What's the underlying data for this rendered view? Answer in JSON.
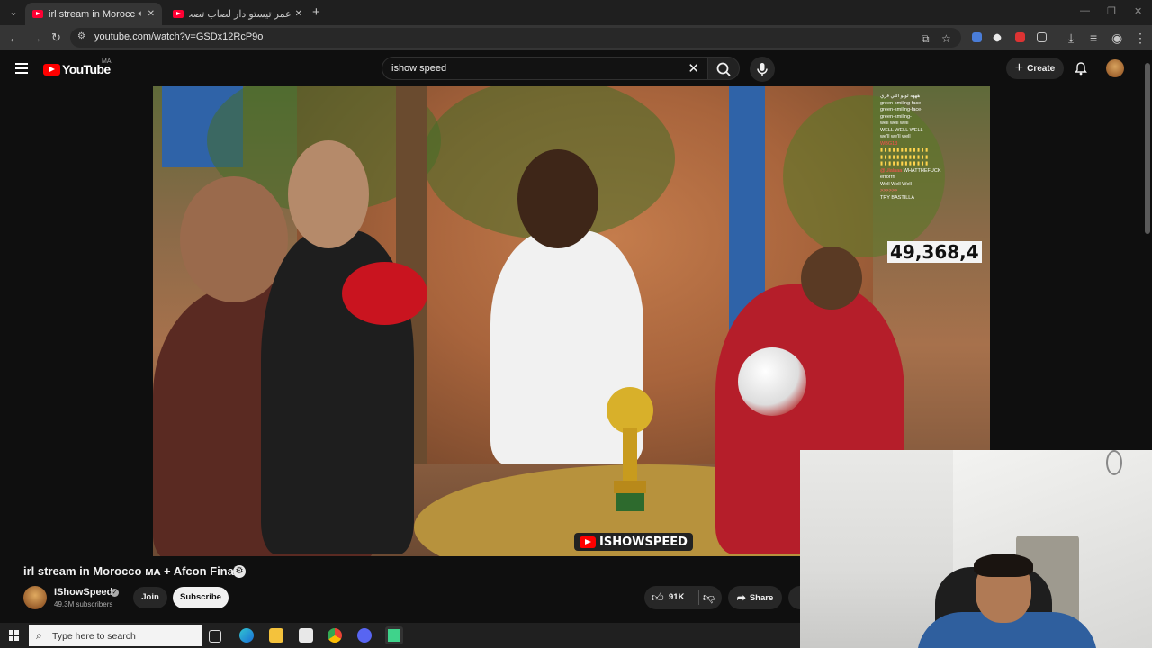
{
  "browser": {
    "tabs": [
      {
        "title": "irl stream in Morocco MA +",
        "active": true
      },
      {
        "title": "عمر تيستو دار لصاب تصب | البرو",
        "active": false
      }
    ],
    "url": "youtube.com/watch?v=GSDx12RcP9o"
  },
  "header": {
    "logo_text": "YouTube",
    "country_code": "MA",
    "search_query": "ishow speed",
    "create_label": "Create"
  },
  "video": {
    "live_chat": [
      {
        "user": "",
        "msg": "هههه لولو اللي فري"
      },
      {
        "user": "",
        "msg": "green-smiling-face-"
      },
      {
        "user": "",
        "msg": "green-smiling-face-"
      },
      {
        "user": "",
        "msg": "green-smiling-"
      },
      {
        "user": "",
        "msg": "well well well"
      },
      {
        "user": "",
        "msg": "WELL WELL WELL"
      },
      {
        "user": "",
        "msg": "we'll we'll well"
      },
      {
        "user": "WBG13",
        "msg": ""
      },
      {
        "user": "",
        "msg": ""
      },
      {
        "user": "@Ulalaaa",
        "msg": "WHATTHEFUCK"
      },
      {
        "user": "",
        "msg": "errorrrr"
      },
      {
        "user": "",
        "msg": "Well Well Well"
      },
      {
        "user": "",
        "msg": ""
      },
      {
        "user": "",
        "msg": "TRY BASTILLA"
      }
    ],
    "viewer_count": "49,368,4",
    "watermark": "ISHOWSPEED"
  },
  "details": {
    "title": "irl stream in Morocco ᴍᴀ + Afcon Final",
    "channel_name": "IShowSpeed",
    "subscribers": "49.3M subscribers",
    "join_label": "Join",
    "subscribe_label": "Subscribe",
    "likes": "91K",
    "share_label": "Share"
  },
  "taskbar": {
    "search_placeholder": "Type here to search"
  }
}
